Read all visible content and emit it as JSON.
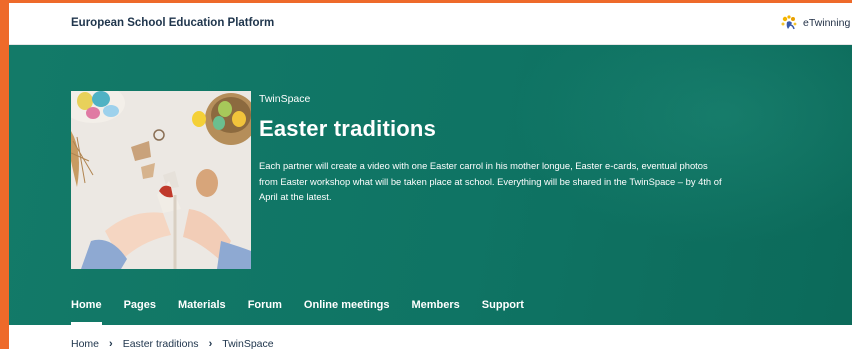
{
  "header": {
    "platform_title": "European School Education Platform",
    "brand_text": "eTwinning"
  },
  "hero": {
    "kicker": "TwinSpace",
    "title": "Easter traditions",
    "description": "Each partner will create a video with one Easter carrol in his mother longue, Easter e-cards, eventual photos from Easter workshop what will be taken place at school. Everything will be shared in the TwinSpace – by 4th of April at the latest."
  },
  "tabs": [
    {
      "label": "Home",
      "active": true
    },
    {
      "label": "Pages"
    },
    {
      "label": "Materials"
    },
    {
      "label": "Forum"
    },
    {
      "label": "Online meetings"
    },
    {
      "label": "Members"
    },
    {
      "label": "Support"
    }
  ],
  "breadcrumb": {
    "items": [
      "Home",
      "Easter traditions",
      "TwinSpace"
    ],
    "separator": "›"
  },
  "colors": {
    "accent_orange": "#ee6a2a",
    "hero_green": "#0f7464",
    "text_dark": "#20364d"
  }
}
